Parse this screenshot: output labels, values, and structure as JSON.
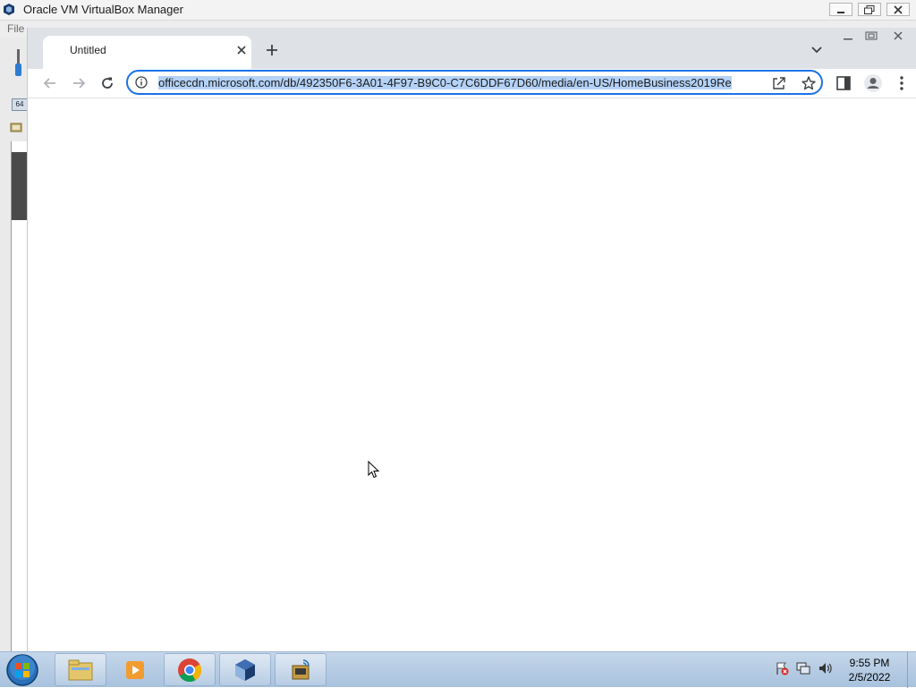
{
  "virtualbox": {
    "title": "Oracle VM VirtualBox Manager",
    "menu_file": "File",
    "badge": "64"
  },
  "browser": {
    "tab_title": "Untitled",
    "url": "officecdn.microsoft.com/db/492350F6-3A01-4F97-B9C0-C7C6DDF67D60/media/en-US/HomeBusiness2019Re",
    "accent_color": "#1a73e8",
    "selection_color": "#b4d2f7"
  },
  "taskbar": {
    "apps": [
      {
        "name": "explorer-icon"
      },
      {
        "name": "media-player-icon"
      },
      {
        "name": "chrome-icon"
      },
      {
        "name": "virtualbox-icon"
      },
      {
        "name": "network-app-icon"
      }
    ],
    "time": "9:55 PM",
    "date": "2/5/2022"
  }
}
